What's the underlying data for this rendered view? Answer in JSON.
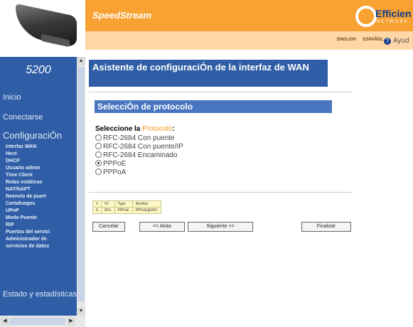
{
  "header": {
    "brand": "SpeedStream",
    "logo_main": "Efficien",
    "logo_sub": "NETWORK",
    "languages": [
      "ENGLISH",
      "ESPAÑOL"
    ],
    "help": "Ayud"
  },
  "sidebar": {
    "model": "5200",
    "nav": [
      "Inicio",
      "Conectarse",
      "ConfiguraciÓn"
    ],
    "sub_items": [
      "Interfaz WAN",
      "Host",
      "DHCP",
      "Usuario admin",
      "Time Client",
      "Rutas estáticas",
      "NAT/NAPT",
      "Reenvío de puert",
      "Cortafuegos",
      "UPnP",
      "Modo Puente",
      "RIP",
      "Puertos del servici",
      "Administrador de",
      "servicios de datos"
    ],
    "status": "Estado y estadísticas"
  },
  "main": {
    "title": "Asistente de configuraciÓn de la interfaz de WAN",
    "section": "SelecciÓn de protocolo",
    "select_prefix": "Seleccione la ",
    "select_highlight": "Protocolo",
    "select_suffix": ":",
    "protocols": [
      {
        "label": "RFC-2684 Con puente",
        "checked": false
      },
      {
        "label": "RFC-2684 Con puente/IP",
        "checked": false
      },
      {
        "label": "RFC-2684 Encaminado",
        "checked": false
      },
      {
        "label": "PPPoE",
        "checked": true
      },
      {
        "label": "PPPoA",
        "checked": false
      }
    ],
    "vc_table": {
      "headers": [
        "#",
        "VC",
        "Type",
        "Nombre"
      ],
      "rows": [
        [
          "0",
          "0/01",
          "PPPoE",
          "PPPoE@0/01"
        ]
      ]
    },
    "buttons": {
      "cancel": "Cancelar",
      "back": "<< Atrás",
      "next": "Siguiente >>",
      "finish": "Finalizar"
    }
  }
}
